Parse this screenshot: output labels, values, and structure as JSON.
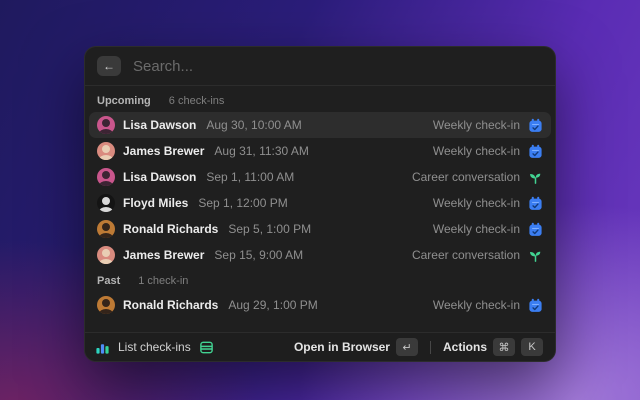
{
  "colors": {
    "accent_blue": "#3b7ef2",
    "accent_green": "#42d392",
    "panel_bg": "#1f1f1f",
    "row_selected_bg": "#2d2d2d",
    "background_top_left": "#1f1a5e",
    "background_top_right": "#5a2cb4",
    "background_bottom_right": "#a080dc",
    "background_bottom_left": "#94265c"
  },
  "search": {
    "placeholder": "Search...",
    "back_icon": "←"
  },
  "sections": [
    {
      "title": "Upcoming",
      "count_label": "6 check-ins",
      "items": [
        {
          "name": "Lisa Dawson",
          "datetime": "Aug 30, 10:00 AM",
          "type": "Weekly check-in",
          "icon": "calendar-check-icon",
          "selected": true,
          "avatar_bg": "#c9568c",
          "avatar_fg": "#3c2433"
        },
        {
          "name": "James Brewer",
          "datetime": "Aug 31, 11:30 AM",
          "type": "Weekly check-in",
          "icon": "calendar-check-icon",
          "selected": false,
          "avatar_bg": "#d98b7f",
          "avatar_fg": "#e9ceb4"
        },
        {
          "name": "Lisa Dawson",
          "datetime": "Sep 1, 11:00 AM",
          "type": "Career conversation",
          "icon": "sprout-icon",
          "selected": false,
          "avatar_bg": "#c9568c",
          "avatar_fg": "#3c2433"
        },
        {
          "name": "Floyd Miles",
          "datetime": "Sep 1, 12:00 PM",
          "type": "Weekly check-in",
          "icon": "calendar-check-icon",
          "selected": false,
          "avatar_bg": "#141414",
          "avatar_fg": "#d8d8d8"
        },
        {
          "name": "Ronald Richards",
          "datetime": "Sep 5, 1:00 PM",
          "type": "Weekly check-in",
          "icon": "calendar-check-icon",
          "selected": false,
          "avatar_bg": "#bd7a35",
          "avatar_fg": "#34241a"
        },
        {
          "name": "James Brewer",
          "datetime": "Sep 15, 9:00 AM",
          "type": "Career conversation",
          "icon": "sprout-icon",
          "selected": false,
          "avatar_bg": "#d98b7f",
          "avatar_fg": "#e9ceb4"
        }
      ]
    },
    {
      "title": "Past",
      "count_label": "1 check-in",
      "items": [
        {
          "name": "Ronald Richards",
          "datetime": "Aug 29, 1:00 PM",
          "type": "Weekly check-in",
          "icon": "calendar-check-icon",
          "selected": false,
          "avatar_bg": "#bd7a35",
          "avatar_fg": "#34241a"
        }
      ]
    }
  ],
  "footer": {
    "command_icon": "bar-chart-icon",
    "command_label": "List check-ins",
    "accessory_icon": "book-icon",
    "primary_action_label": "Open in Browser",
    "primary_action_key": "↵",
    "actions_label": "Actions",
    "actions_keys": [
      "⌘",
      "K"
    ]
  }
}
